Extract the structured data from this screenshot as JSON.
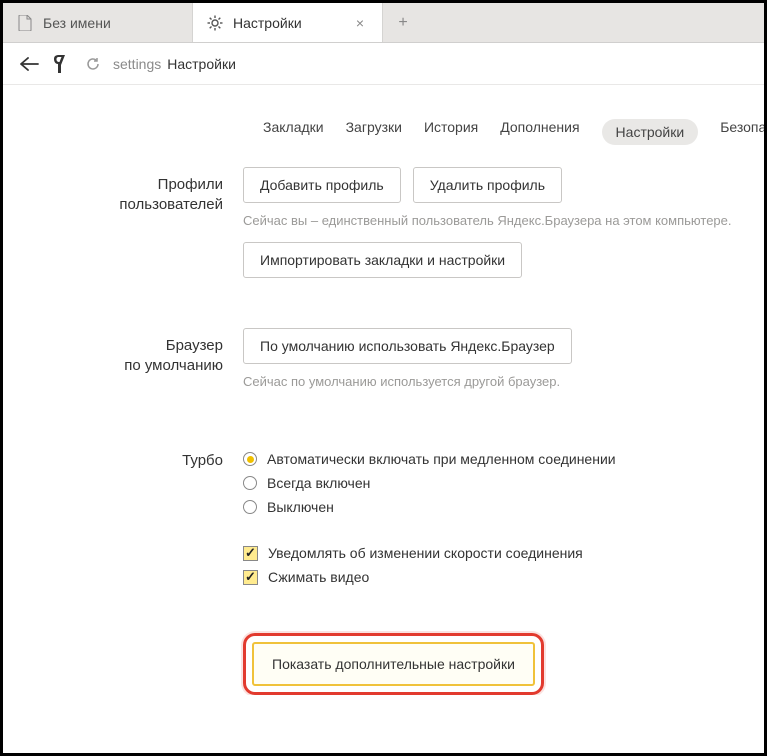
{
  "tabs": [
    {
      "title": "Без имени",
      "icon": "page",
      "active": false
    },
    {
      "title": "Настройки",
      "icon": "gear",
      "active": true
    }
  ],
  "address": {
    "prefix": "settings",
    "title": "Настройки"
  },
  "nav": {
    "items": [
      "Закладки",
      "Загрузки",
      "История",
      "Дополнения",
      "Настройки",
      "Безопасност"
    ],
    "active_index": 4
  },
  "sections": {
    "profiles": {
      "label_line1": "Профили",
      "label_line2": "пользователей",
      "btn_add": "Добавить профиль",
      "btn_remove": "Удалить профиль",
      "hint": "Сейчас вы – единственный пользователь Яндекс.Браузера на этом компьютере.",
      "btn_import": "Импортировать закладки и настройки"
    },
    "default_browser": {
      "label_line1": "Браузер",
      "label_line2": "по умолчанию",
      "btn_set_default": "По умолчанию использовать Яндекс.Браузер",
      "hint": "Сейчас по умолчанию используется другой браузер."
    },
    "turbo": {
      "label": "Турбо",
      "opt_auto": "Автоматически включать при медленном соединении",
      "opt_always": "Всегда включен",
      "opt_off": "Выключен",
      "selected": "auto",
      "chk_notify": "Уведомлять об изменении скорости соединения",
      "chk_compress": "Сжимать видео",
      "notify_checked": true,
      "compress_checked": true
    }
  },
  "advanced_button": "Показать дополнительные настройки"
}
